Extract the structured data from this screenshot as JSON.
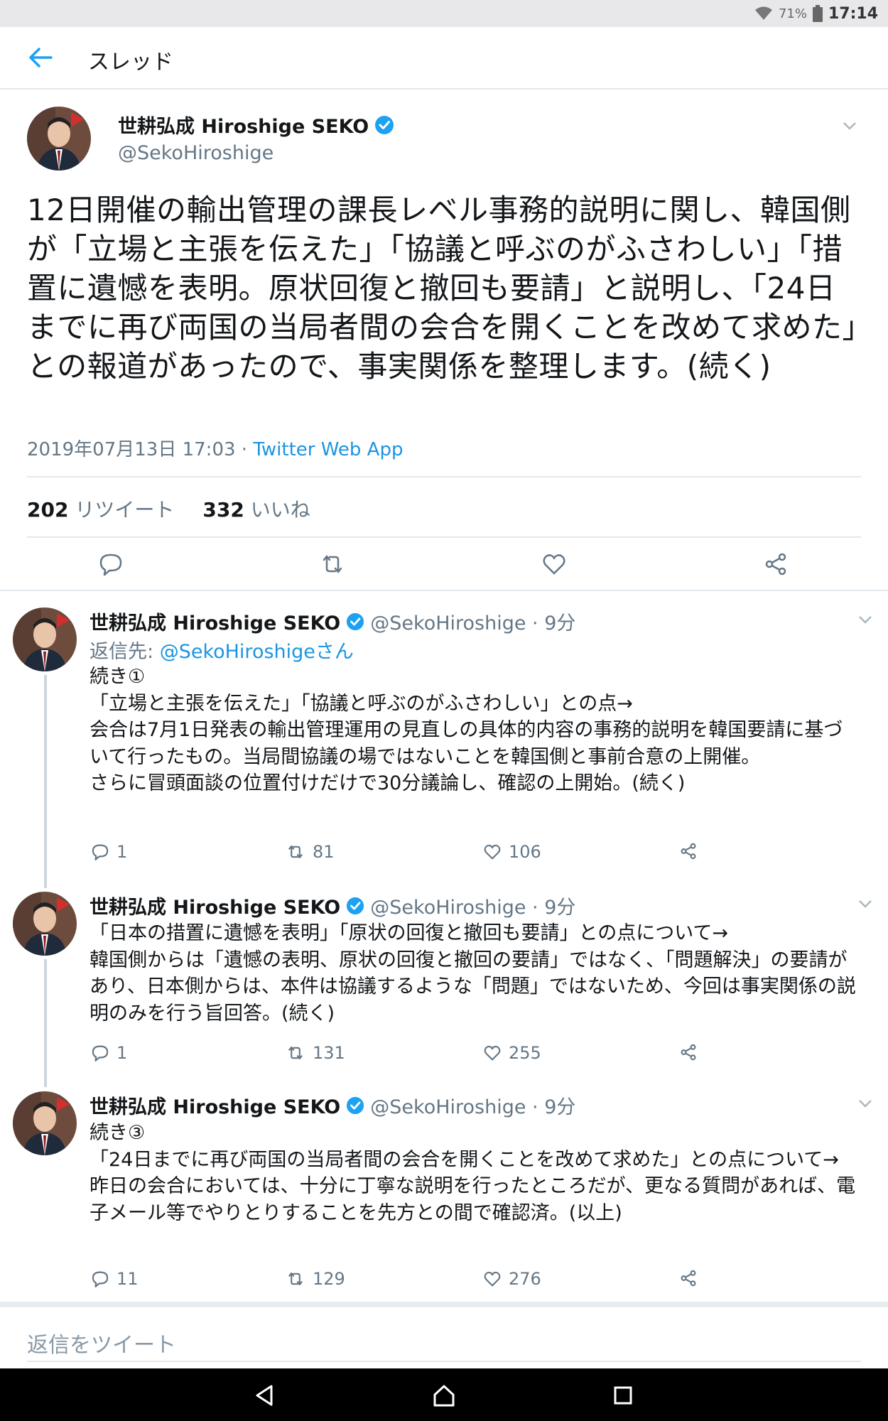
{
  "status_bar": {
    "battery": "71%",
    "time": "17:14"
  },
  "header": {
    "title": "スレッド"
  },
  "main_tweet": {
    "name": "世耕弘成 Hiroshige SEKO",
    "handle": "@SekoHiroshige",
    "text": "12日開催の輸出管理の課長レベル事務的説明に関し、韓国側が「立場と主張を伝えた」「協議と呼ぶのがふさわしい」「措置に遺憾を表明。原状回復と撤回も要請」と説明し、「24日までに再び両国の当局者間の会合を開くことを改めて求めた」との報道があったので、事実関係を整理します。(続く)",
    "timestamp": "2019年07月13日 17:03",
    "source": "Twitter Web App",
    "retweet_count": "202",
    "retweet_label": "リツイート",
    "like_count": "332",
    "like_label": "いいね"
  },
  "replies": [
    {
      "name": "世耕弘成 Hiroshige SEKO",
      "handle": "@SekoHiroshige · 9分",
      "reply_to_prefix": "返信先: ",
      "reply_to": "@SekoHiroshigeさん",
      "text": "続き①\n「立場と主張を伝えた」「協議と呼ぶのがふさわしい」との点→\n会合は7月1日発表の輸出管理運用の見直しの具体的内容の事務的説明を韓国要請に基づいて行ったもの。当局間協議の場ではないことを韓国側と事前合意の上開催。\nさらに冒頭面談の位置付けだけで30分議論し、確認の上開始。(続く)",
      "replies": "1",
      "retweets": "81",
      "likes": "106"
    },
    {
      "name": "世耕弘成 Hiroshige SEKO",
      "handle": "@SekoHiroshige · 9分",
      "text": "「日本の措置に遺憾を表明」「原状の回復と撤回も要請」との点について→\n韓国側からは「遺憾の表明、原状の回復と撤回の要請」ではなく、「問題解決」の要請があり、日本側からは、本件は協議するような「問題」ではないため、今回は事実関係の説明のみを行う旨回答。(続く)",
      "replies": "1",
      "retweets": "131",
      "likes": "255"
    },
    {
      "name": "世耕弘成 Hiroshige SEKO",
      "handle": "@SekoHiroshige · 9分",
      "text": "続き③\n「24日までに再び両国の当局者間の会合を開くことを改めて求めた」との点について→\n昨日の会合においては、十分に丁寧な説明を行ったところだが、更なる質問があれば、電子メール等でやりとりすることを先方との間で確認済。(以上)",
      "replies": "11",
      "retweets": "129",
      "likes": "276"
    }
  ],
  "reply_input": {
    "placeholder": "返信をツイート"
  },
  "colors": {
    "accent": "#1da1f2",
    "link": "#1b95e0",
    "secondary_text": "#657786",
    "divider": "#e1e8ed"
  }
}
